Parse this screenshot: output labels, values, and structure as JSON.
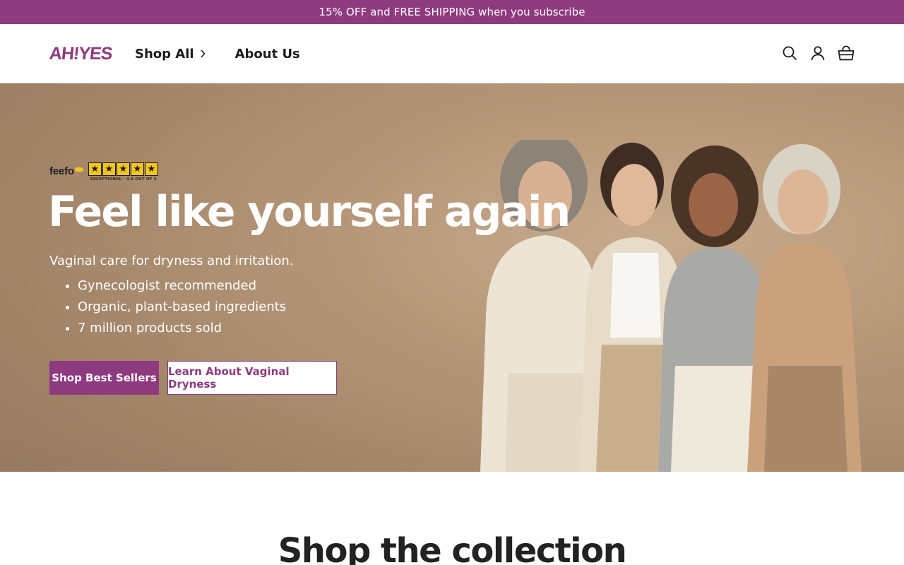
{
  "announcement": {
    "text": "15% OFF and FREE SHIPPING when you subscribe"
  },
  "header": {
    "logo_text": "AH!YES",
    "nav": [
      {
        "label": "Shop All",
        "has_chevron": true
      },
      {
        "label": "About Us",
        "has_chevron": false
      }
    ],
    "icons": [
      "search-icon",
      "account-icon",
      "cart-icon"
    ]
  },
  "hero": {
    "rating": {
      "brand": "feefo",
      "stars": 5,
      "caption": "EXCEPTIONAL · 4.8 OUT OF 5"
    },
    "title": "Feel like yourself again",
    "subtitle": "Vaginal care for dryness and irritation.",
    "bullets": [
      "Gynecologist recommended",
      "Organic, plant-based ingredients",
      "7 million products sold"
    ],
    "primary_button": "Shop Best Sellers",
    "secondary_button": "Learn About Vaginal Dryness"
  },
  "collection": {
    "title": "Shop the collection"
  },
  "colors": {
    "brand": "#8e3a7f",
    "hero_background": "#b8997a",
    "star": "#f4c51c",
    "text_dark": "#1f1f1f"
  }
}
